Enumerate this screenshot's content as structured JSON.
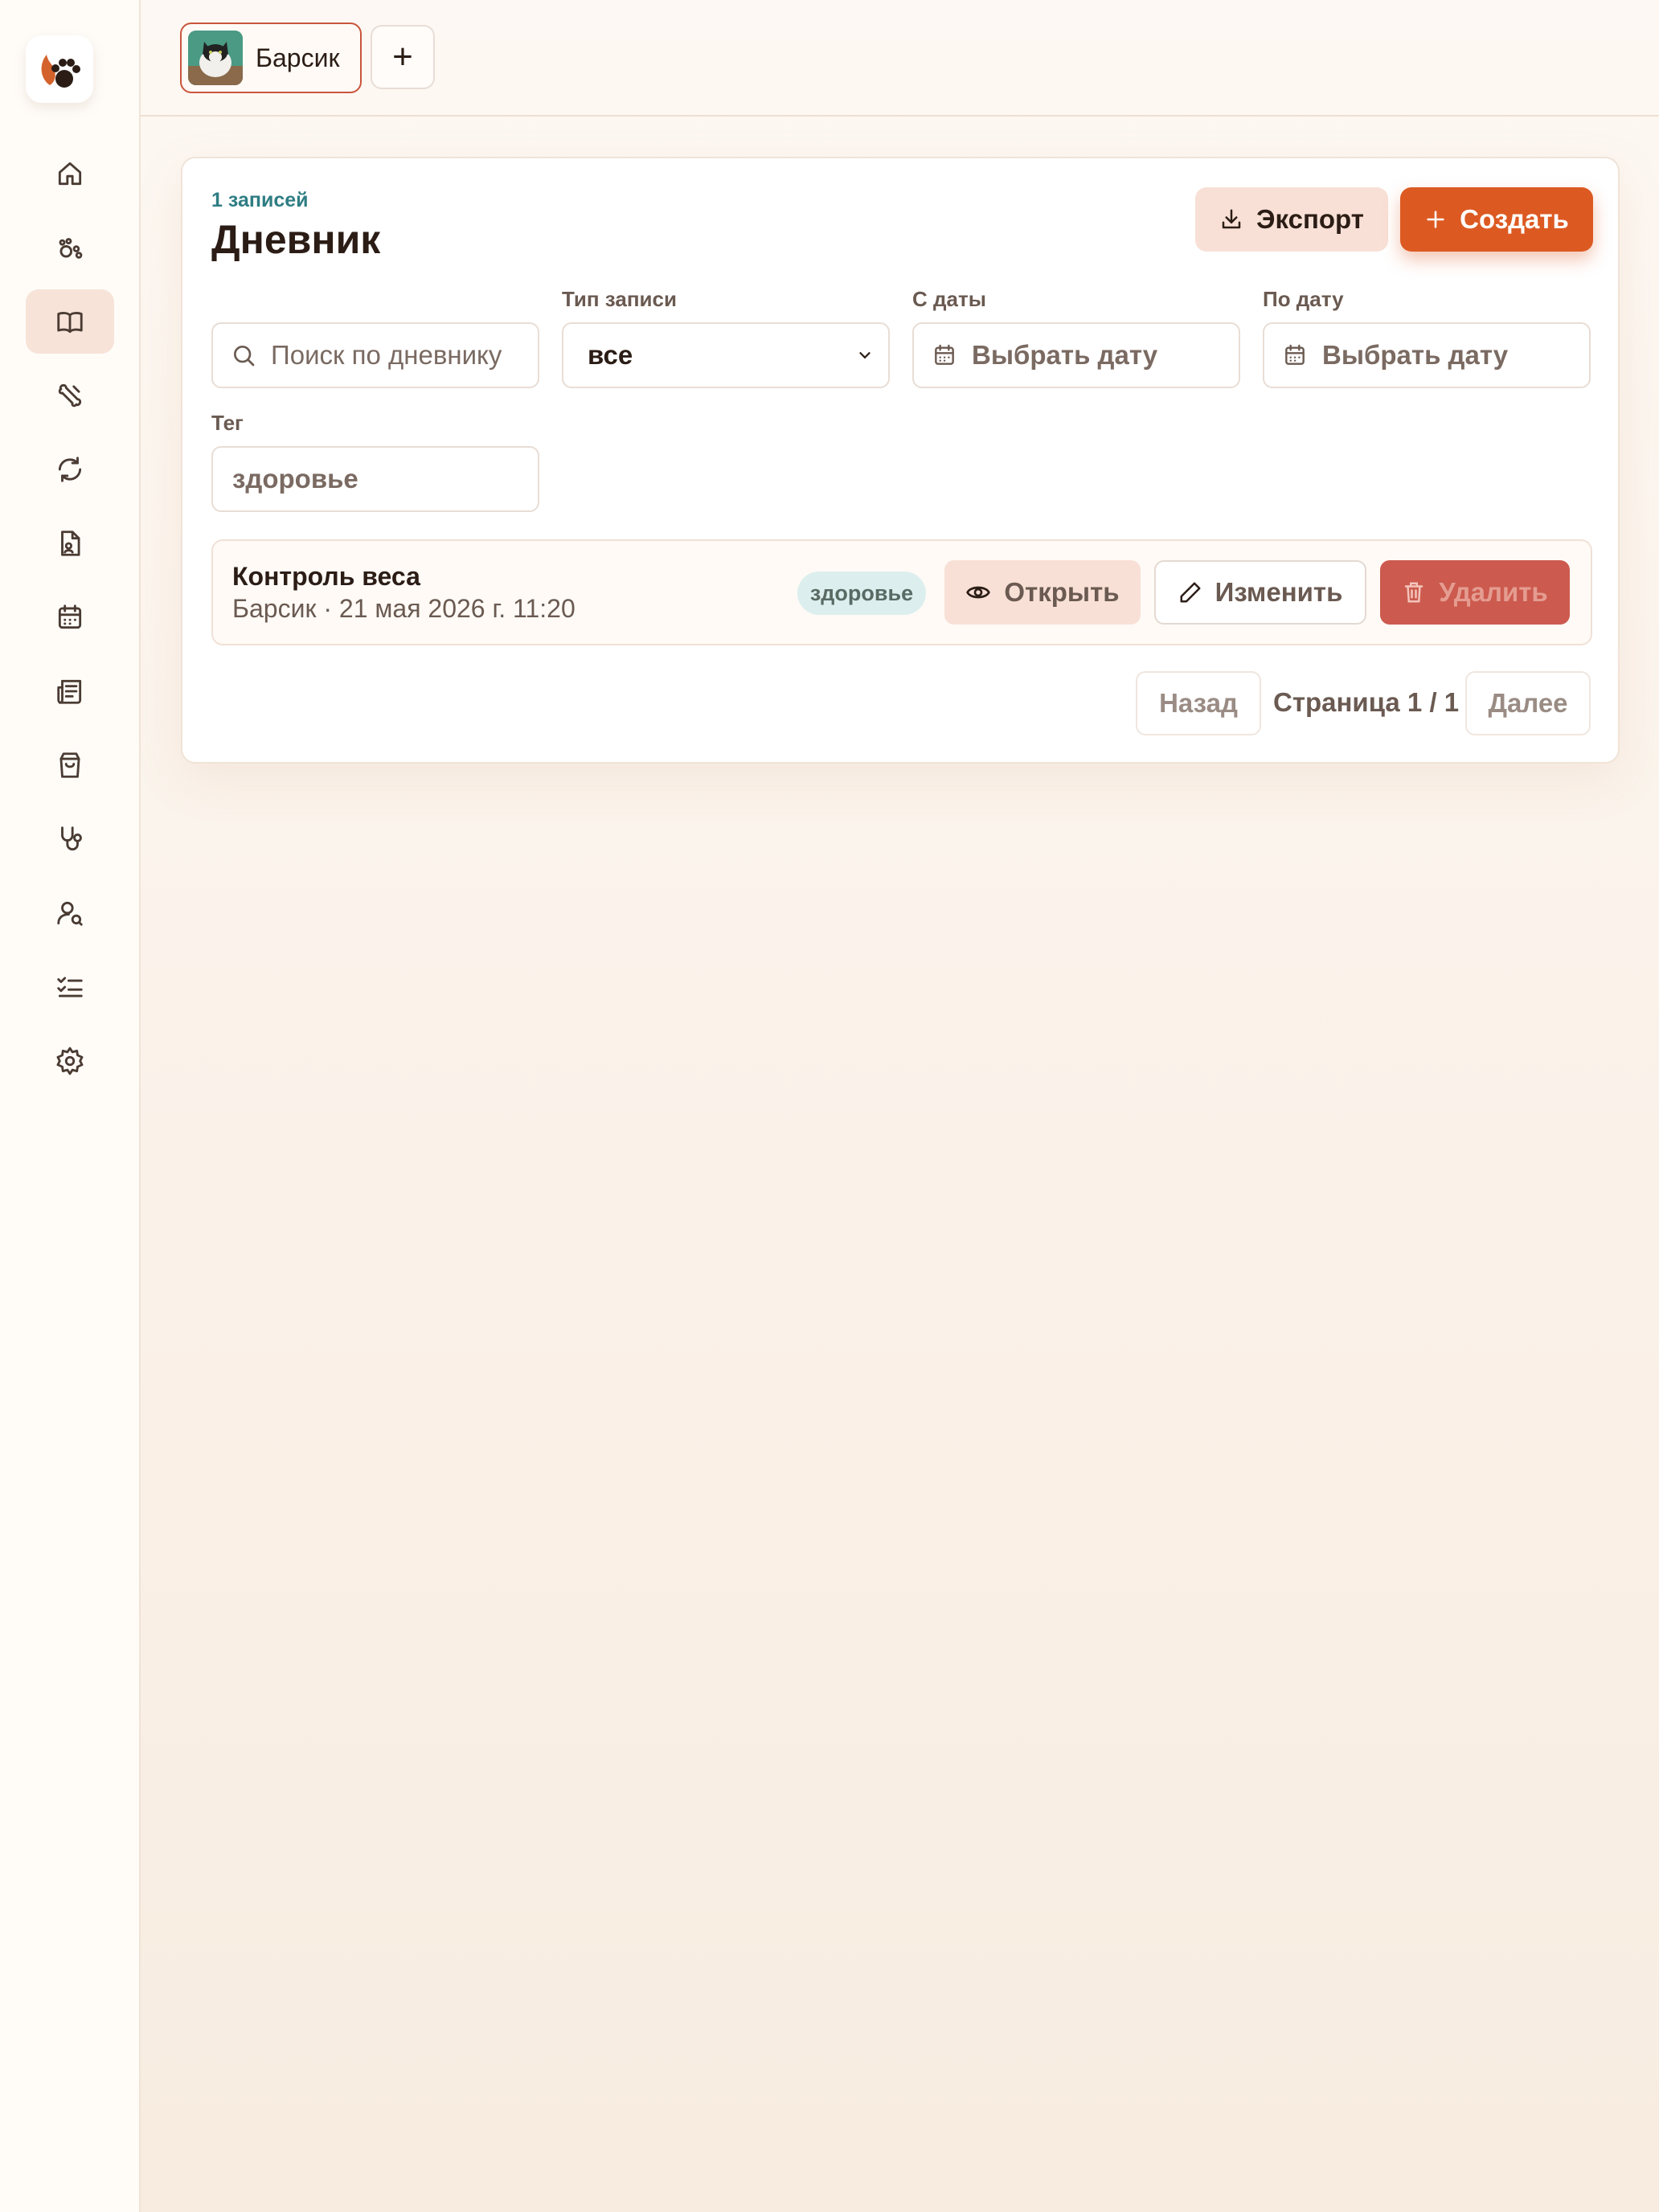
{
  "colors": {
    "accent": "#dc5a22",
    "active_nav": "#f7e3d8",
    "danger": "#cc5a4e",
    "count_text": "#2e7d83",
    "tag_bg": "#dcefee"
  },
  "sidebar": {
    "logo": "paw-logo",
    "items": [
      {
        "icon": "home-icon",
        "active": false
      },
      {
        "icon": "paws-icon",
        "active": false
      },
      {
        "icon": "book-open-icon",
        "active": true
      },
      {
        "icon": "bone-icon",
        "active": false
      },
      {
        "icon": "refresh-icon",
        "active": false
      },
      {
        "icon": "document-icon",
        "active": false
      },
      {
        "icon": "calendar-icon",
        "active": false
      },
      {
        "icon": "newspaper-icon",
        "active": false
      },
      {
        "icon": "shopping-bag-icon",
        "active": false
      },
      {
        "icon": "stethoscope-icon",
        "active": false
      },
      {
        "icon": "user-search-icon",
        "active": false
      },
      {
        "icon": "checklist-icon",
        "active": false
      },
      {
        "icon": "settings-icon",
        "active": false
      }
    ]
  },
  "topbar": {
    "pet_name": "Барсик",
    "add_label": "+"
  },
  "header": {
    "count": "1 записей",
    "title": "Дневник",
    "export_label": "Экспорт",
    "create_label": "Создать"
  },
  "filters": {
    "search_placeholder": "Поиск по дневнику",
    "type_label": "Тип записи",
    "type_value": "все",
    "from_label": "С даты",
    "from_placeholder": "Выбрать дату",
    "to_label": "По дату",
    "to_placeholder": "Выбрать дату",
    "tag_label": "Тег",
    "tag_value": "здоровье"
  },
  "entries": [
    {
      "title": "Контроль веса",
      "meta": "Барсик · 21 мая 2026 г. 11:20",
      "tag": "здоровье",
      "open_label": "Открыть",
      "edit_label": "Изменить",
      "delete_label": "Удалить"
    }
  ],
  "pagination": {
    "prev_label": "Назад",
    "page_text": "Страница 1 / 1",
    "next_label": "Далее"
  }
}
